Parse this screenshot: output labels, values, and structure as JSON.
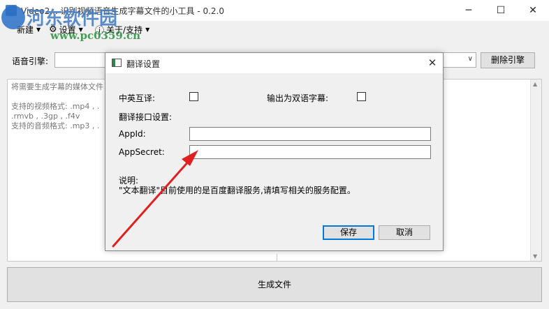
{
  "window": {
    "title": "Video2... 识别视频语音生成字幕文件的小工具 - 0.2.0",
    "controls": {
      "minimize": "─",
      "maximize": "☐",
      "close": "✕"
    }
  },
  "watermark": {
    "name": "河东软件园",
    "url": "www.pc0359.cn"
  },
  "menu": {
    "new_label": "新建",
    "settings_label": "设置",
    "about_label": "关于/支持"
  },
  "engine": {
    "label": "语音引擎:",
    "selected": "",
    "delete_label": "删除引擎"
  },
  "drop_area": {
    "text": "将需要生成字幕的媒体文件\n\n支持的视频格式: .mp4 , .\n.rmvb , .3gp , .f4v\n支持的音频格式: .mp3 , ."
  },
  "generate_label": "生成文件",
  "dialog": {
    "title": "翻译设置",
    "close": "✕",
    "zh_en_label": "中英互译:",
    "zh_en_checked": false,
    "bilingual_label": "输出为双语字幕:",
    "bilingual_checked": false,
    "api_section_label": "翻译接口设置:",
    "appid_label": "AppId:",
    "appid_value": "",
    "appsecret_label": "AppSecret:",
    "appsecret_value": "",
    "note_title": "说明:",
    "note_text": "\"文本翻译\"目前使用的是百度翻译服务,请填写相关的服务配置。",
    "save_label": "保存",
    "cancel_label": "取消"
  },
  "colors": {
    "annotation_arrow": "#e02020",
    "default_button_border": "#0078d7"
  }
}
